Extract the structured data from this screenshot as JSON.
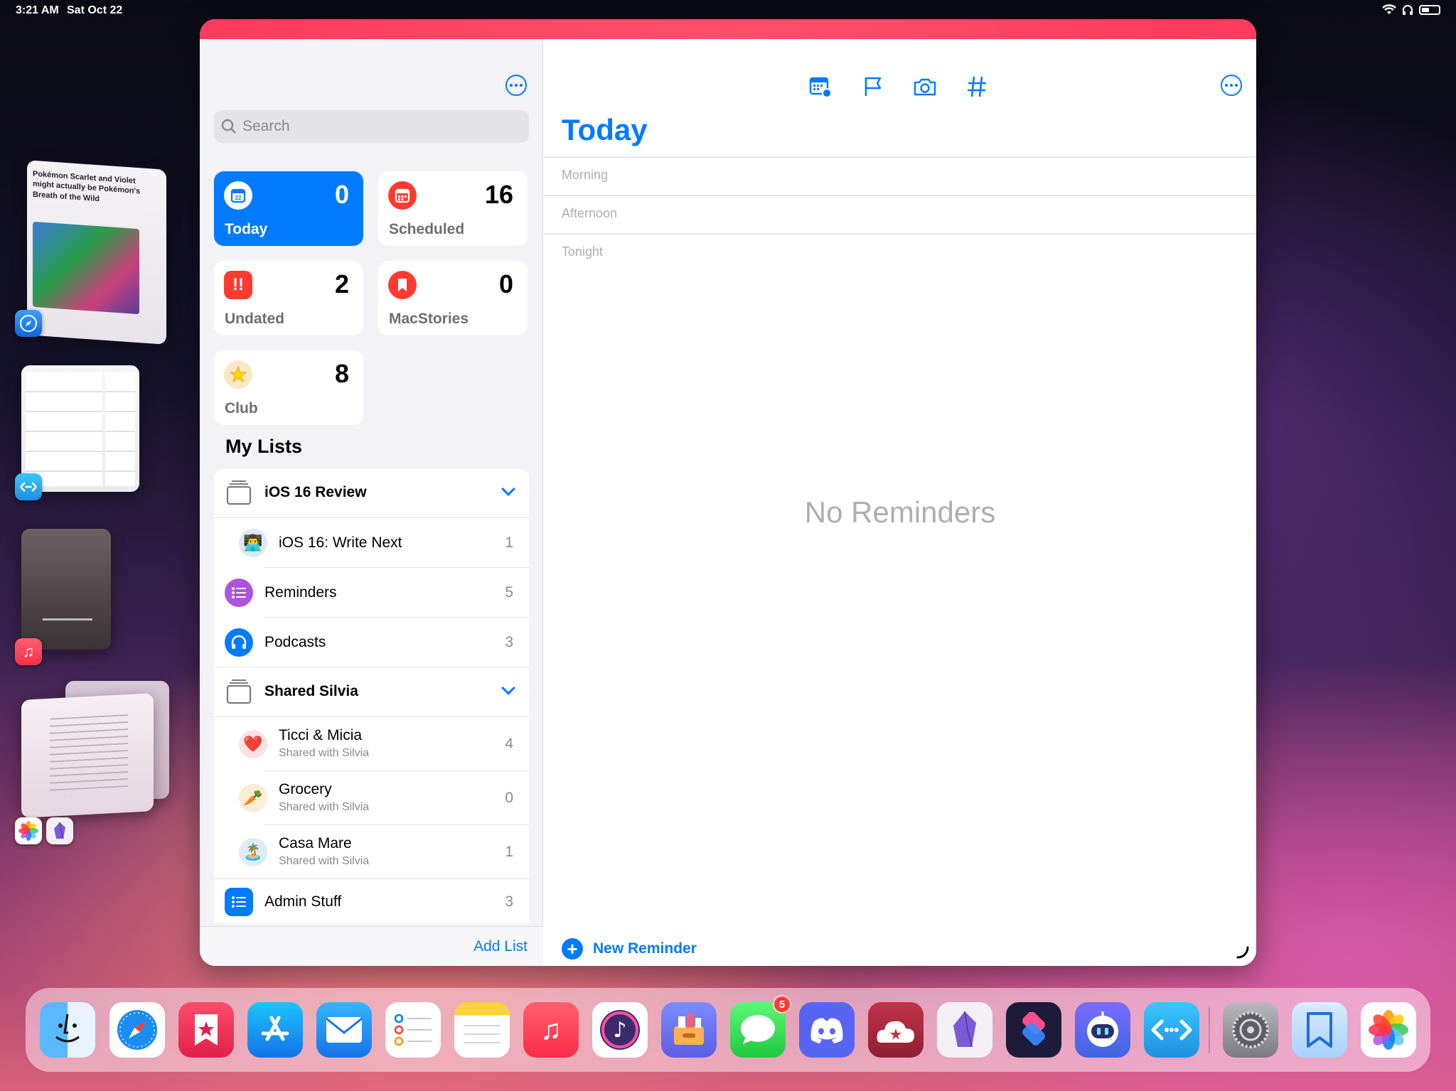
{
  "status_bar": {
    "time": "3:21 AM",
    "date": "Sat Oct 22"
  },
  "thumbnails": {
    "article_headline": "Pokémon Scarlet and Violet might actually be Pokémon's Breath of the Wild"
  },
  "search": {
    "placeholder": "Search"
  },
  "smart_lists": [
    {
      "label": "Today",
      "count": "0",
      "icon": "calendar-today-icon",
      "color": "#007aff"
    },
    {
      "label": "Scheduled",
      "count": "16",
      "icon": "calendar-icon",
      "color": "#ff3b30"
    },
    {
      "label": "Undated",
      "count": "2",
      "icon": "exclamation-icon",
      "color": "#ff3b30"
    },
    {
      "label": "MacStories",
      "count": "0",
      "icon": "bookmark-icon",
      "color": "#ff3b30"
    },
    {
      "label": "Club",
      "count": "8",
      "icon": "star-icon",
      "color": "#ffd60a"
    }
  ],
  "my_lists": {
    "title": "My Lists",
    "items": [
      {
        "label": "iOS 16 Review",
        "type": "group"
      },
      {
        "label": "iOS 16: Write Next",
        "count": "1",
        "emoji": "🧑‍💻"
      },
      {
        "label": "Reminders",
        "count": "5",
        "icon": "list-icon",
        "color": "#af52de"
      },
      {
        "label": "Podcasts",
        "count": "3",
        "icon": "headphones-icon",
        "color": "#007aff"
      },
      {
        "label": "Shared Silvia",
        "type": "group"
      },
      {
        "label": "Ticci & Micia",
        "sub": "Shared with Silvia",
        "count": "4",
        "emoji": "❤️"
      },
      {
        "label": "Grocery",
        "sub": "Shared with Silvia",
        "count": "0",
        "emoji": "🥕"
      },
      {
        "label": "Casa Mare",
        "sub": "Shared with Silvia",
        "count": "1",
        "emoji": "🏝️"
      },
      {
        "label": "Admin Stuff",
        "count": "3",
        "icon": "list-icon",
        "color": "#007aff"
      }
    ]
  },
  "footer": {
    "add_list": "Add List"
  },
  "detail": {
    "title": "Today",
    "sections": [
      "Morning",
      "Afternoon",
      "Tonight"
    ],
    "empty_state": "No Reminders",
    "new_reminder": "New Reminder"
  },
  "dock": {
    "apps": [
      "Finder",
      "Safari",
      "GoodLinks",
      "App Store",
      "Mail",
      "Reminders",
      "Notes",
      "Music",
      "Marvis",
      "Data Jar",
      "Messages",
      "Discord",
      "Mela",
      "Obsidian",
      "Shortcuts",
      "Mastonaut",
      "Screens",
      "Settings",
      "Bookmark",
      "Photos"
    ],
    "messages_badge": "5"
  }
}
